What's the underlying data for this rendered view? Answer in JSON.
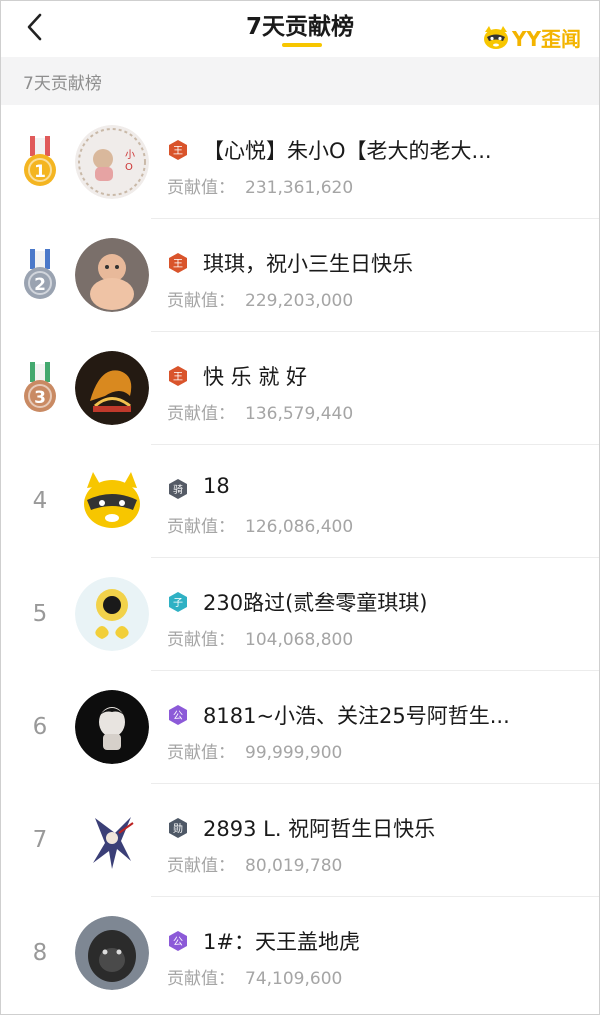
{
  "nav": {
    "title": "7天贡献榜",
    "logo_text": "YY歪闻"
  },
  "section": {
    "header": "7天贡献榜"
  },
  "contribution_label": "贡献值：",
  "entries": [
    {
      "rank": "1",
      "medal": "gold",
      "badge_text": "王",
      "badge_color": "#d9542b",
      "name": "【心悦】朱小O【老大的老大...",
      "value": "231,361,620"
    },
    {
      "rank": "2",
      "medal": "silver",
      "badge_text": "王",
      "badge_color": "#d9542b",
      "name": "琪琪，祝小三生日快乐",
      "value": "229,203,000"
    },
    {
      "rank": "3",
      "medal": "bronze",
      "badge_text": "王",
      "badge_color": "#d9542b",
      "name": "快 乐 就 好",
      "value": "136,579,440"
    },
    {
      "rank": "4",
      "medal": "",
      "badge_text": "骑",
      "badge_color": "#555b66",
      "name": "18",
      "value": "126,086,400"
    },
    {
      "rank": "5",
      "medal": "",
      "badge_text": "子",
      "badge_color": "#2fb1c4",
      "name": "230路过(贰叁零童琪琪)",
      "value": "104,068,800"
    },
    {
      "rank": "6",
      "medal": "",
      "badge_text": "公",
      "badge_color": "#8c5ad8",
      "name": "8181~小浩、关注25号阿哲生...",
      "value": "99,999,900"
    },
    {
      "rank": "7",
      "medal": "",
      "badge_text": "勋",
      "badge_color": "#4e5866",
      "name": "2893 L. 祝阿哲生日快乐",
      "value": "80,019,780"
    },
    {
      "rank": "8",
      "medal": "",
      "badge_text": "公",
      "badge_color": "#8c5ad8",
      "name": "1#：天王盖地虎",
      "value": "74,109,600"
    }
  ],
  "colors": {
    "accent": "#f7c600",
    "gold_medal": "#f4b521",
    "silver_medal": "#9aa3b1",
    "bronze_medal": "#c98a63"
  }
}
